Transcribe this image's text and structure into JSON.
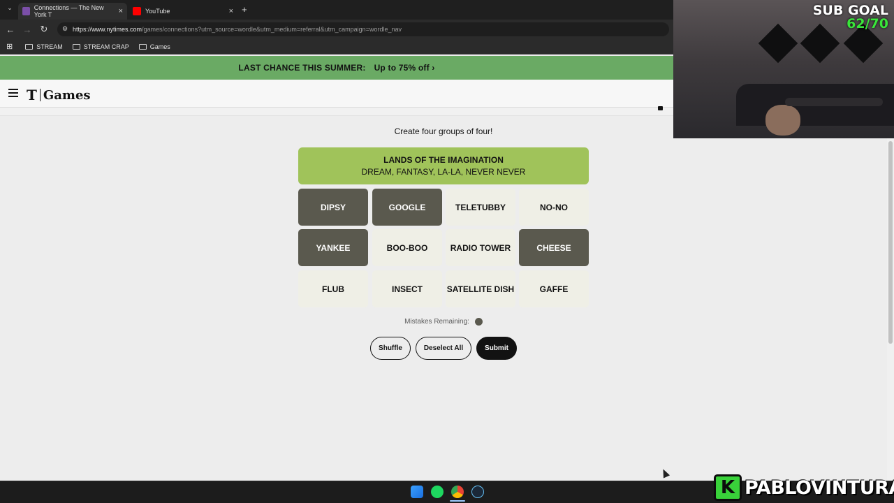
{
  "browser": {
    "tabs": [
      {
        "title": "Connections — The New York T",
        "close": "×"
      },
      {
        "title": "YouTube",
        "close": "×"
      }
    ],
    "new_tab": "+",
    "url_host": "https://www.nytimes.com",
    "url_path": "/games/connections?utm_source=wordle&utm_medium=referral&utm_campaign=wordle_nav",
    "bookmarks": [
      "STREAM",
      "STREAM CRAP",
      "Games"
    ]
  },
  "promo": {
    "text": "LAST CHANCE THIS SUMMER:",
    "offer": "Up to 75% off ›"
  },
  "header": {
    "logo_t": "T",
    "logo_games": "Games"
  },
  "game": {
    "instruction": "Create four groups of four!",
    "solved_group": {
      "title": "LANDS OF THE IMAGINATION",
      "members": "DREAM, FANTASY, LA-LA, NEVER NEVER",
      "color": "#a0c35a"
    },
    "tiles": [
      {
        "word": "DIPSY",
        "selected": true
      },
      {
        "word": "GOOGLE",
        "selected": true
      },
      {
        "word": "TELETUBBY",
        "selected": false
      },
      {
        "word": "NO-NO",
        "selected": false
      },
      {
        "word": "YANKEE",
        "selected": true
      },
      {
        "word": "BOO-BOO",
        "selected": false
      },
      {
        "word": "RADIO TOWER",
        "selected": false
      },
      {
        "word": "CHEESE",
        "selected": true
      },
      {
        "word": "FLUB",
        "selected": false
      },
      {
        "word": "INSECT",
        "selected": false
      },
      {
        "word": "SATELLITE DISH",
        "selected": false
      },
      {
        "word": "GAFFE",
        "selected": false
      }
    ],
    "mistakes_label": "Mistakes Remaining:",
    "mistakes_remaining": 1,
    "buttons": {
      "shuffle": "Shuffle",
      "deselect": "Deselect All",
      "submit": "Submit"
    }
  },
  "overlay": {
    "sub_goal_label": "SUB GOAL",
    "sub_goal_count": "62/70",
    "channel_letter": "K",
    "channel_name": "PABLOVINTURA"
  }
}
